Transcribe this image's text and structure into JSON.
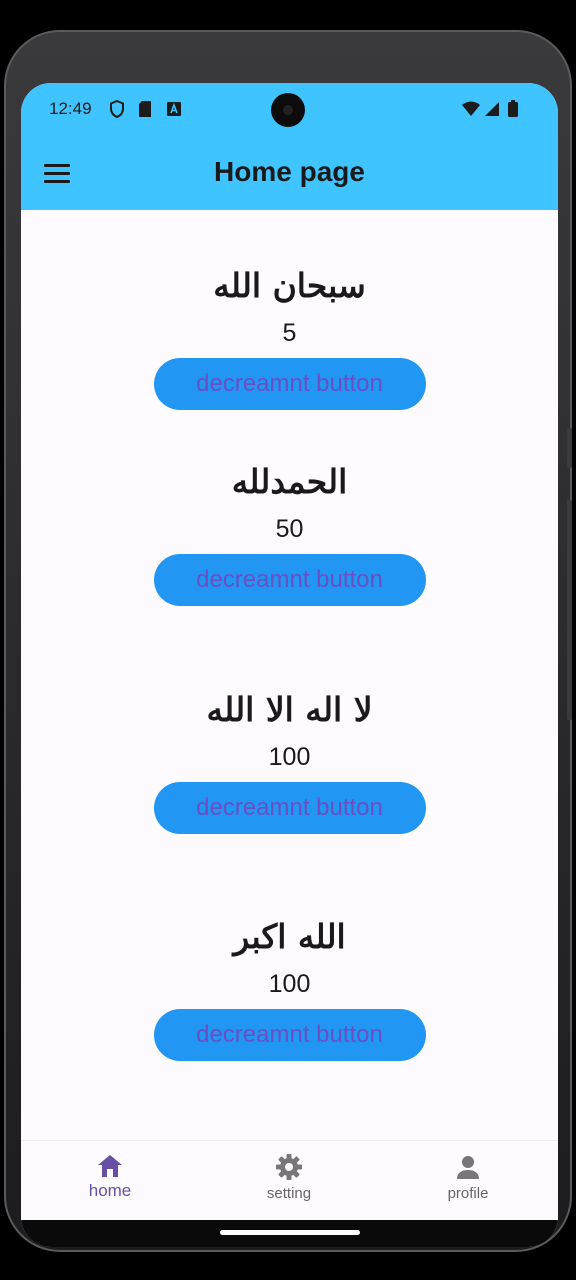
{
  "status_bar": {
    "time": "12:49",
    "left_icons": [
      "shield-icon",
      "sim-card-icon",
      "keyboard-a-icon"
    ],
    "right_icons": [
      "wifi-icon",
      "signal-icon",
      "battery-icon"
    ]
  },
  "app_bar": {
    "title": "Home page",
    "menu_icon": "hamburger-menu-icon",
    "background": "#40c4ff"
  },
  "counters": [
    {
      "phrase": "سبحان الله",
      "count": "5",
      "button_label": "decreamnt button"
    },
    {
      "phrase": "الحمدلله",
      "count": "50",
      "button_label": "decreamnt button"
    },
    {
      "phrase": "لا اله الا الله",
      "count": "100",
      "button_label": "decreamnt button"
    },
    {
      "phrase": "الله اكبر",
      "count": "100",
      "button_label": "decreamnt button"
    }
  ],
  "bottom_nav": {
    "items": [
      {
        "label": "home",
        "icon": "home-icon",
        "active": true
      },
      {
        "label": "setting",
        "icon": "gear-icon",
        "active": false
      },
      {
        "label": "profile",
        "icon": "person-icon",
        "active": false
      }
    ],
    "active_color": "#6750a4"
  },
  "colors": {
    "button_bg": "#2196f3",
    "button_text": "#6a4fc4"
  }
}
